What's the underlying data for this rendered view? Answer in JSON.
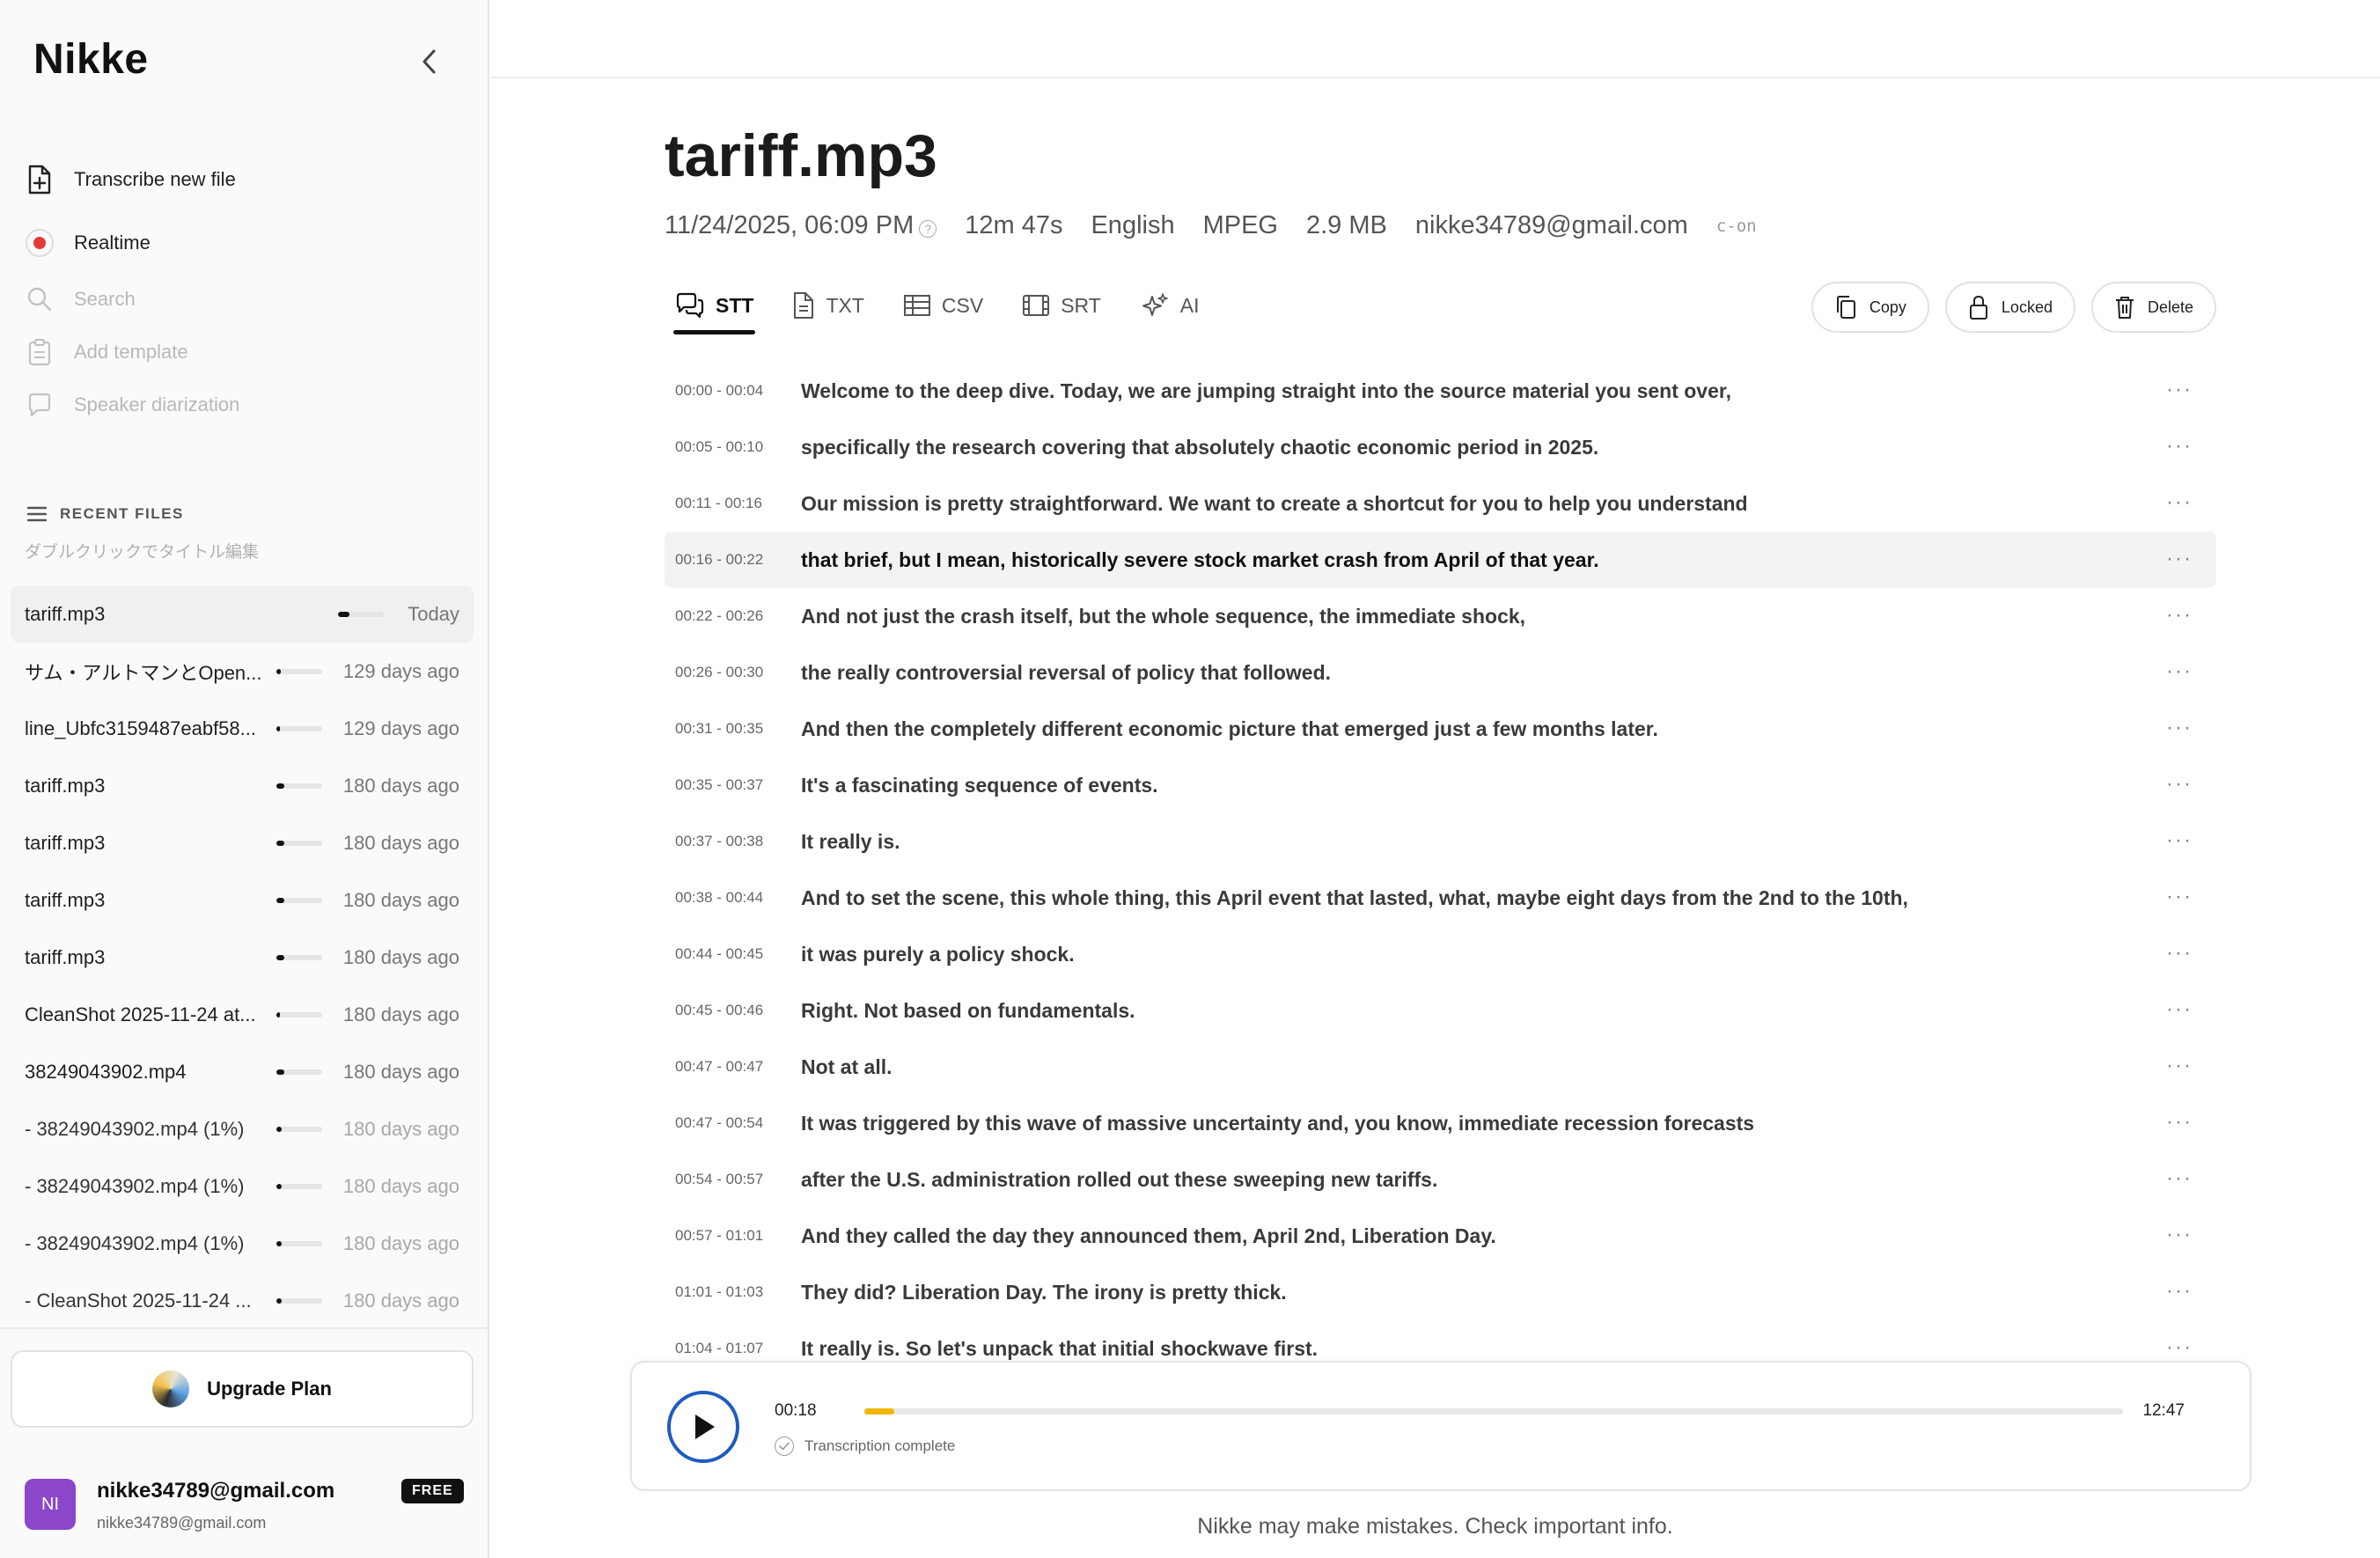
{
  "app": {
    "title": "Nikke"
  },
  "nav": {
    "transcribe": "Transcribe new file",
    "realtime": "Realtime",
    "search": "Search",
    "add_template": "Add template",
    "speaker": "Speaker diarization"
  },
  "recent": {
    "heading": "RECENT FILES",
    "hint": "ダブルクリックでタイトル編集",
    "files": [
      {
        "name": "tariff.mp3",
        "date": "Today",
        "progress": 0.25
      },
      {
        "name": "サム・アルトマンとOpen...",
        "date": "129 days ago",
        "progress": 0.1
      },
      {
        "name": "line_Ubfc3159487eabf58...",
        "date": "129 days ago",
        "progress": 0.08
      },
      {
        "name": "tariff.mp3",
        "date": "180 days ago",
        "progress": 0.18
      },
      {
        "name": "tariff.mp3",
        "date": "180 days ago",
        "progress": 0.18
      },
      {
        "name": "tariff.mp3",
        "date": "180 days ago",
        "progress": 0.18
      },
      {
        "name": "tariff.mp3",
        "date": "180 days ago",
        "progress": 0.18
      },
      {
        "name": "CleanShot 2025-11-24 at...",
        "date": "180 days ago",
        "progress": 0.08
      },
      {
        "name": "38249043902.mp4",
        "date": "180 days ago",
        "progress": 0.18
      },
      {
        "name": "- 38249043902.mp4 (1%)",
        "date": "180 days ago",
        "progress": 0.12
      },
      {
        "name": "- 38249043902.mp4 (1%)",
        "date": "180 days ago",
        "progress": 0.12
      },
      {
        "name": "- 38249043902.mp4 (1%)",
        "date": "180 days ago",
        "progress": 0.12
      },
      {
        "name": "- CleanShot 2025-11-24 ...",
        "date": "180 days ago",
        "progress": 0.12
      }
    ]
  },
  "upgrade": {
    "label": "Upgrade Plan"
  },
  "user": {
    "initials": "NI",
    "name": "nikke34789@gmail.com",
    "email": "nikke34789@gmail.com",
    "plan": "FREE"
  },
  "file": {
    "title": "tariff.mp3",
    "datetime": "11/24/2025, 06:09 PM",
    "duration": "12m 47s",
    "language": "English",
    "format": "MPEG",
    "size": "2.9 MB",
    "owner": "nikke34789@gmail.com",
    "tag": "c-on"
  },
  "tabs": [
    "STT",
    "TXT",
    "CSV",
    "SRT",
    "AI"
  ],
  "actions": {
    "copy": "Copy",
    "locked": "Locked",
    "delete": "Delete"
  },
  "segments": [
    {
      "time": "00:00 - 00:04",
      "text": "Welcome to the deep dive. Today, we are jumping straight into the source material you sent over,"
    },
    {
      "time": "00:05 - 00:10",
      "text": "specifically the research covering that absolutely chaotic economic period in 2025."
    },
    {
      "time": "00:11 - 00:16",
      "text": "Our mission is pretty straightforward. We want to create a shortcut for you to help you understand"
    },
    {
      "time": "00:16 - 00:22",
      "text": "that brief, but I mean, historically severe stock market crash from April of that year."
    },
    {
      "time": "00:22 - 00:26",
      "text": "And not just the crash itself, but the whole sequence, the immediate shock,"
    },
    {
      "time": "00:26 - 00:30",
      "text": "the really controversial reversal of policy that followed."
    },
    {
      "time": "00:31 - 00:35",
      "text": "And then the completely different economic picture that emerged just a few months later."
    },
    {
      "time": "00:35 - 00:37",
      "text": "It's a fascinating sequence of events."
    },
    {
      "time": "00:37 - 00:38",
      "text": "It really is."
    },
    {
      "time": "00:38 - 00:44",
      "text": "And to set the scene, this whole thing, this April event that lasted, what, maybe eight days from the 2nd to the 10th,"
    },
    {
      "time": "00:44 - 00:45",
      "text": "it was purely a policy shock."
    },
    {
      "time": "00:45 - 00:46",
      "text": "Right. Not based on fundamentals."
    },
    {
      "time": "00:47 - 00:47",
      "text": "Not at all."
    },
    {
      "time": "00:47 - 00:54",
      "text": "It was triggered by this wave of massive uncertainty and, you know, immediate recession forecasts"
    },
    {
      "time": "00:54 - 00:57",
      "text": "after the U.S. administration rolled out these sweeping new tariffs."
    },
    {
      "time": "00:57 - 01:01",
      "text": "And they called the day they announced them, April 2nd, Liberation Day."
    },
    {
      "time": "01:01 - 01:03",
      "text": "They did? Liberation Day. The irony is pretty thick."
    },
    {
      "time": "01:04 - 01:07",
      "text": "It really is. So let's unpack that initial shockwave first."
    }
  ],
  "highlight_index": 3,
  "player": {
    "current": "00:18",
    "total": "12:47",
    "progress": 0.024,
    "status": "Transcription complete"
  },
  "footer": "Nikke may make mistakes. Check important info.",
  "colors": {
    "accent_play": "#1f5bbf",
    "progress": "#f2b705",
    "avatar": "#8b46c9",
    "record_dot": "#e53935"
  }
}
